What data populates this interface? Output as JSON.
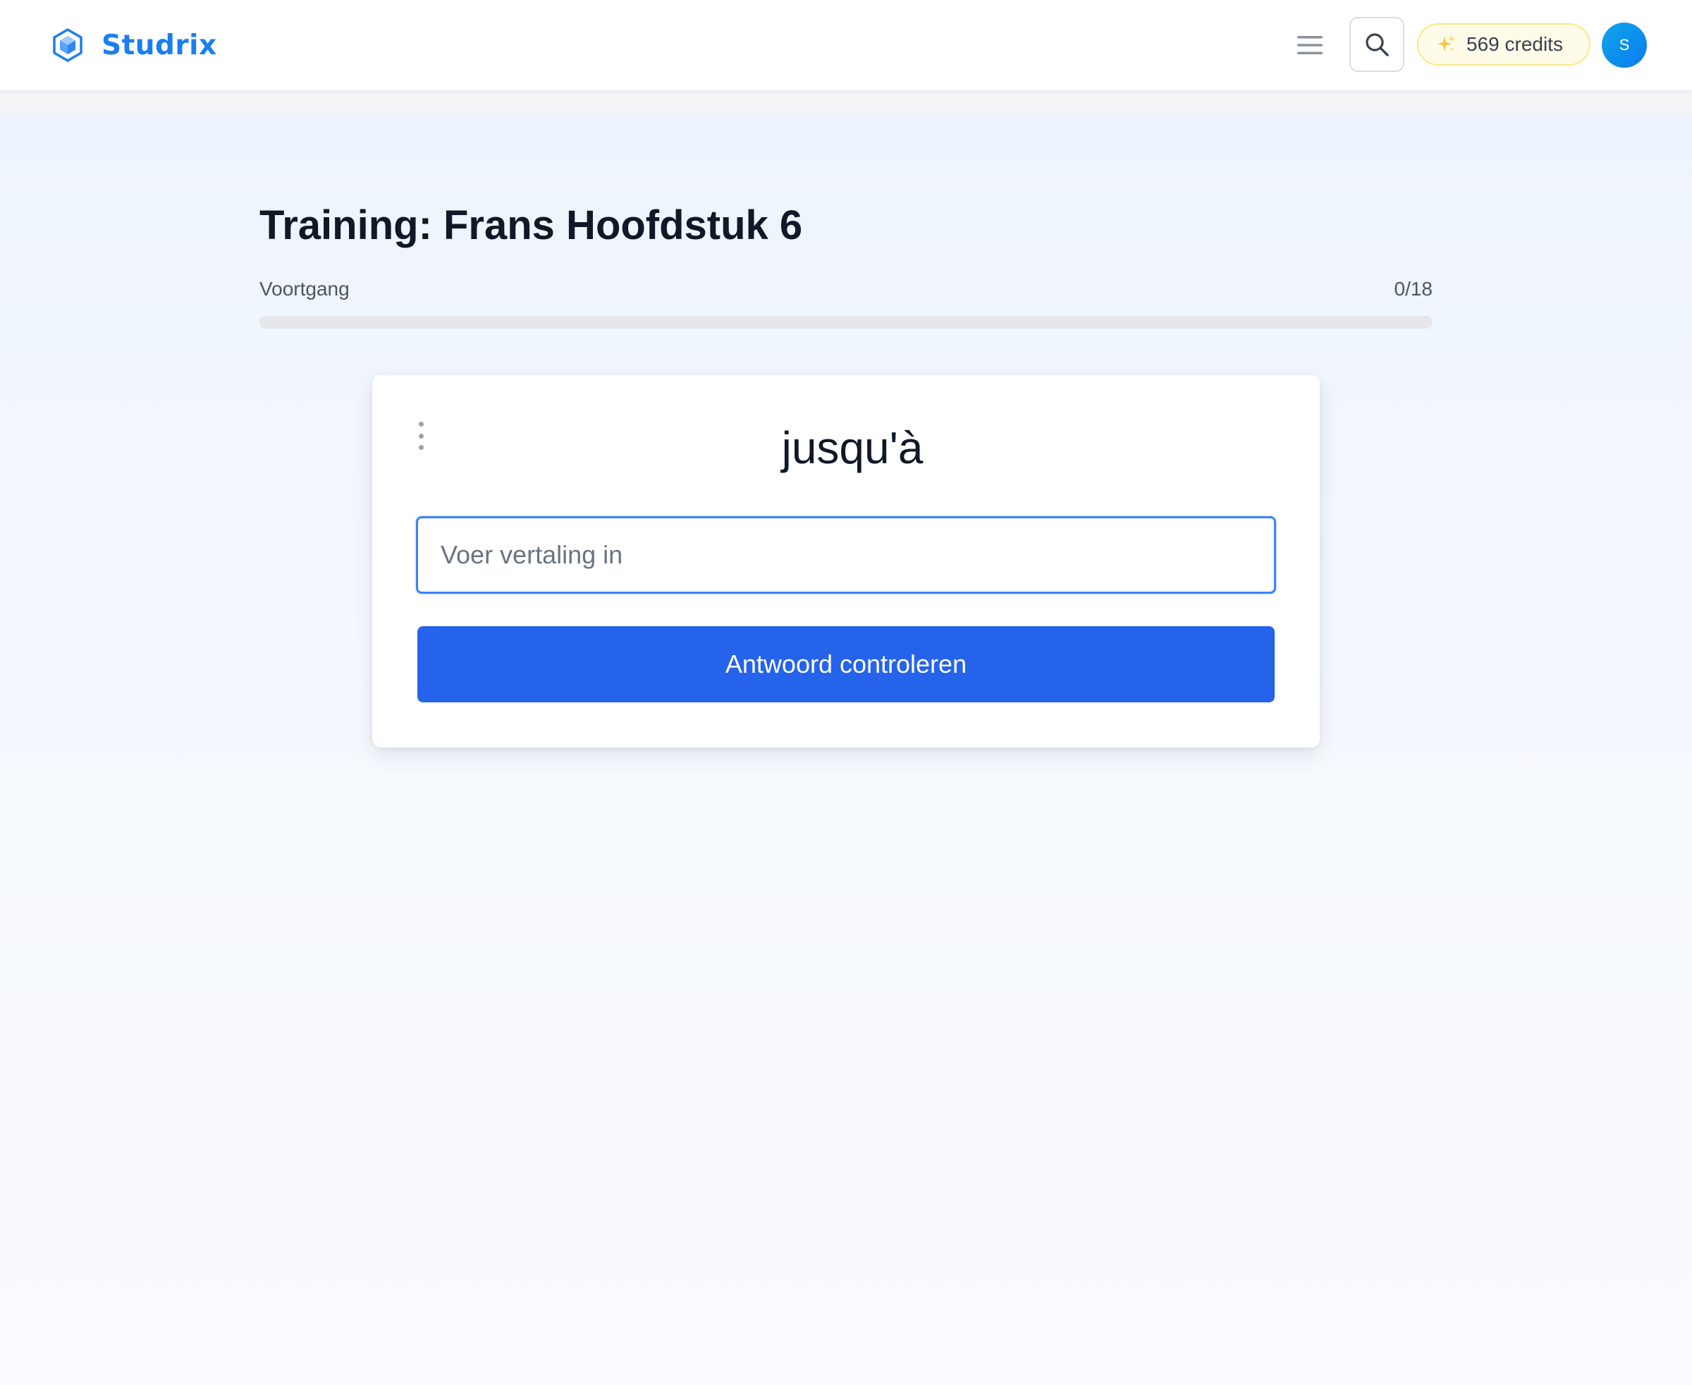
{
  "header": {
    "brand_name": "Studrix",
    "logo_icon": "hexagon-cube-icon",
    "menu_icon": "hamburger-menu-icon",
    "search_icon": "search-icon",
    "credits_icon": "sparkle-icon",
    "credits_label": "569 credits",
    "avatar_initial": "S"
  },
  "training": {
    "title": "Training: Frans Hoofdstuk 6",
    "progress_label": "Voortgang",
    "progress_count": "0/18",
    "progress_fraction": 0
  },
  "card": {
    "word": "jusqu'à",
    "answer_value": "",
    "answer_placeholder": "Voer vertaling in",
    "check_label": "Antwoord controleren",
    "options_icon": "vertical-dots-icon"
  },
  "colors": {
    "brand": "#1a7ef0",
    "primary_button": "#2563eb",
    "input_focus_border": "#3b82f6",
    "credits_background": "#fefbe8",
    "credits_border": "#fde68a",
    "progress_track": "#e5e7eb",
    "page_background": "#eef4fd"
  }
}
